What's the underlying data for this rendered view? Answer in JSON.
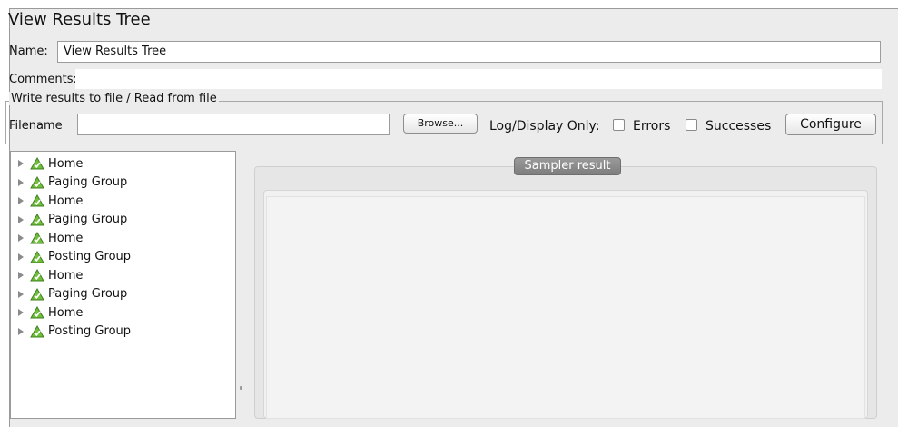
{
  "panel": {
    "title": "View Results Tree"
  },
  "name_field": {
    "label": "Name:",
    "value": "View Results Tree"
  },
  "comments": {
    "label": "Comments:"
  },
  "file_group": {
    "legend": "Write results to file / Read from file",
    "filename_label": "Filename",
    "filename_value": "",
    "browse_label": "Browse...",
    "log_display_label": "Log/Display Only:",
    "errors_label": "Errors",
    "successes_label": "Successes",
    "configure_label": "Configure"
  },
  "tree": {
    "items": [
      {
        "label": "Home",
        "icon": "success-shield-icon"
      },
      {
        "label": "Paging Group",
        "icon": "success-shield-icon"
      },
      {
        "label": "Home",
        "icon": "success-shield-icon"
      },
      {
        "label": "Paging Group",
        "icon": "success-shield-icon"
      },
      {
        "label": "Home",
        "icon": "success-shield-icon"
      },
      {
        "label": "Posting Group",
        "icon": "success-shield-icon"
      },
      {
        "label": "Home",
        "icon": "success-shield-icon"
      },
      {
        "label": "Paging Group",
        "icon": "success-shield-icon"
      },
      {
        "label": "Home",
        "icon": "success-shield-icon"
      },
      {
        "label": "Posting Group",
        "icon": "success-shield-icon"
      }
    ]
  },
  "result_tabs": {
    "active_tab": "Sampler result"
  },
  "colors": {
    "panel_bg": "#ececec",
    "tab_active": "#8a8a8a",
    "success_icon_green": "#6fbf3a"
  }
}
